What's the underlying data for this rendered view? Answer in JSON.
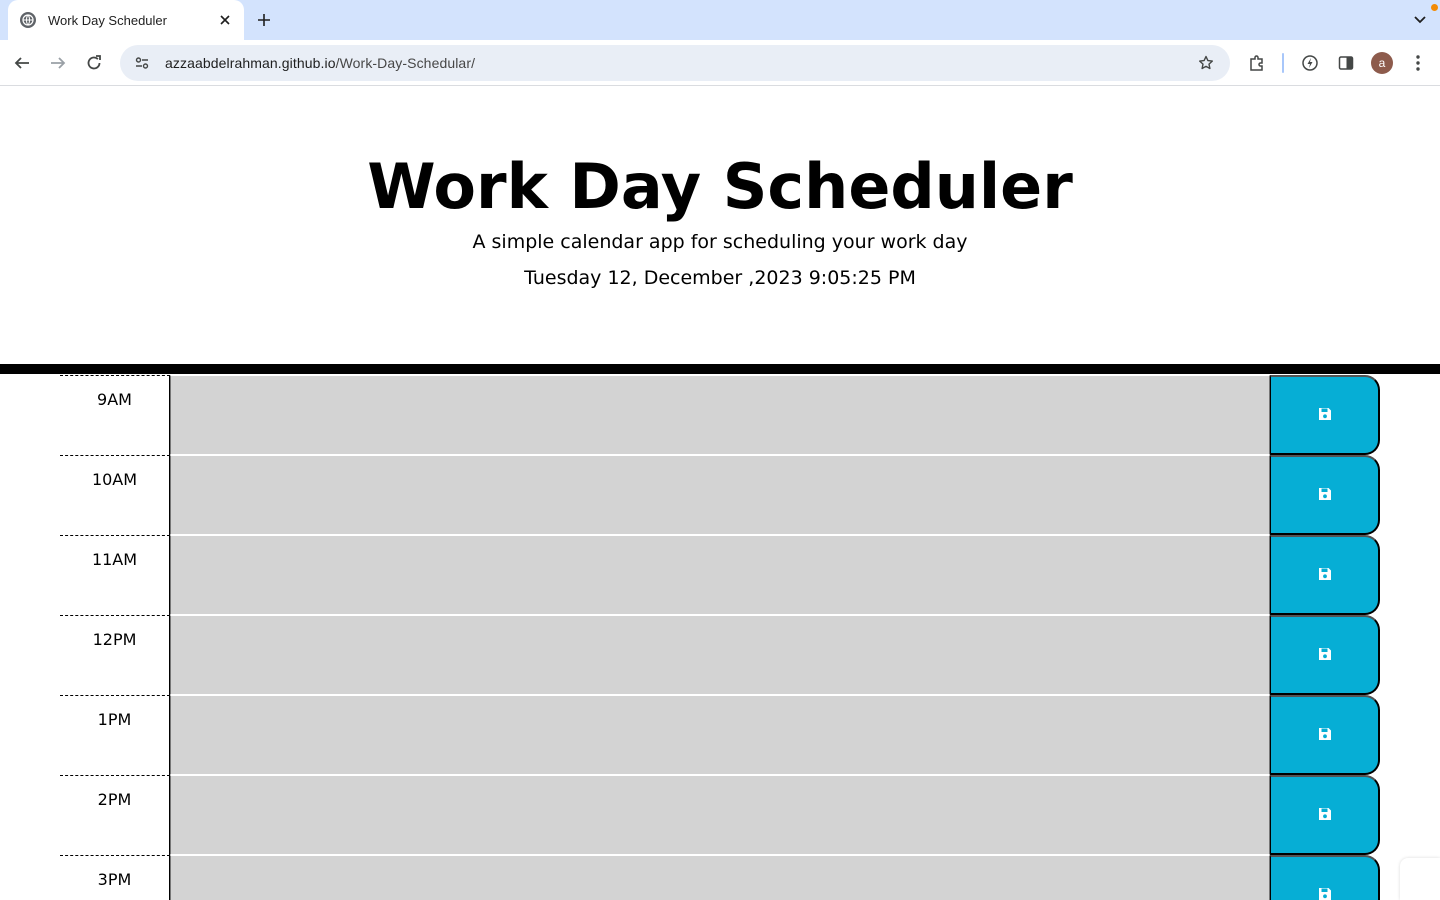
{
  "browser": {
    "tab_title": "Work Day Scheduler",
    "url_host": "azzaabdelrahman.github.io",
    "url_path": "/Work-Day-Schedular/",
    "profile_initial": "a",
    "icons": [
      "globe-icon",
      "close-icon",
      "plus-icon",
      "chevron-down-icon",
      "back-arrow-icon",
      "forward-arrow-icon",
      "reload-icon",
      "site-settings-icon",
      "star-icon",
      "extensions-icon",
      "performance-icon",
      "side-panel-icon",
      "more-vert-icon"
    ]
  },
  "header": {
    "title": "Work Day Scheduler",
    "lead": "A simple calendar app for scheduling your work day",
    "current_day": "Tuesday 12, December ,2023 9:05:25 PM"
  },
  "schedule": {
    "rows": [
      {
        "hour": "9AM",
        "text": ""
      },
      {
        "hour": "10AM",
        "text": ""
      },
      {
        "hour": "11AM",
        "text": ""
      },
      {
        "hour": "12PM",
        "text": ""
      },
      {
        "hour": "1PM",
        "text": ""
      },
      {
        "hour": "2PM",
        "text": ""
      },
      {
        "hour": "3PM",
        "text": ""
      }
    ],
    "save_icon": "save-icon"
  },
  "colors": {
    "past_bg": "#d3d3d3",
    "save_bg": "#06aed5",
    "tabbar_bg": "#d3e3fd"
  }
}
